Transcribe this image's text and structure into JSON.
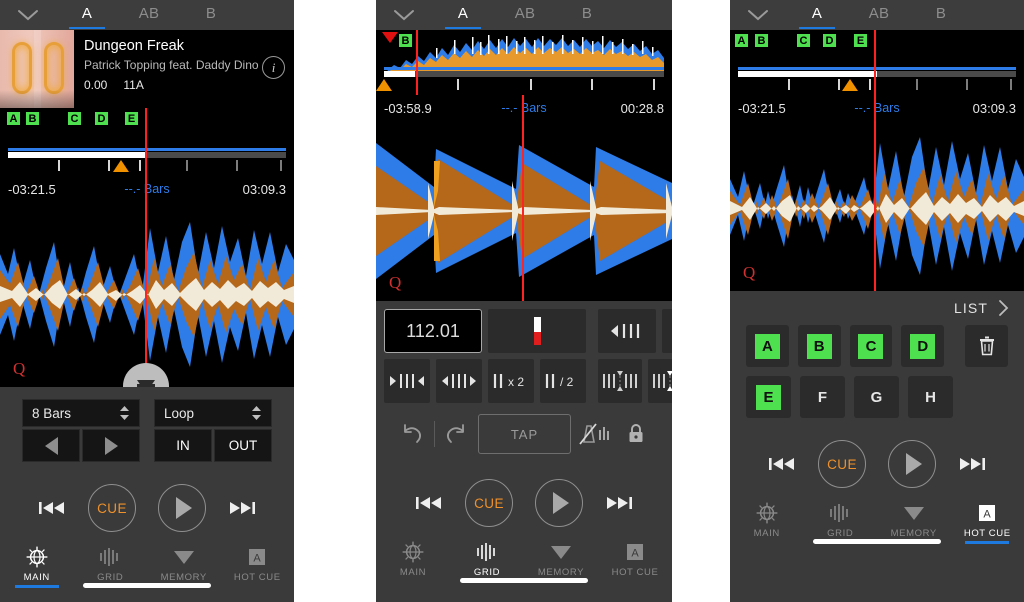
{
  "header": {
    "chevron_icon": "chevron-down-icon",
    "tabs": [
      {
        "label": "A",
        "active": true
      },
      {
        "label": "AB",
        "active": false
      },
      {
        "label": "B",
        "active": false
      }
    ]
  },
  "track": {
    "title": "Dungeon Freak",
    "artist": "Patrick Topping feat. Daddy Dino",
    "gain": "0.00",
    "key": "11A",
    "info_icon": "info-icon"
  },
  "panel1": {
    "overview": {
      "cue_markers": [
        {
          "label": "A",
          "left_pct": 1
        },
        {
          "label": "B",
          "left_pct": 8
        },
        {
          "label": "C",
          "left_pct": 23
        },
        {
          "label": "D",
          "left_pct": 32
        },
        {
          "label": "E",
          "left_pct": 43
        },
        {
          "label": "",
          "left_pct": -99
        }
      ],
      "playhead_pct": 49,
      "position_marker_pct": 42
    },
    "time": {
      "elapsed_remaining": "-03:21.5",
      "bars": "--.- Bars",
      "total": "03:09.3"
    },
    "waveform_cue_label": "Q",
    "beatjump": {
      "value": "8 Bars",
      "prev_icon": "triangle-left-icon",
      "next_icon": "triangle-right-icon"
    },
    "loop": {
      "value": "Loop",
      "in_label": "IN",
      "out_label": "OUT"
    }
  },
  "panel2": {
    "overview": {
      "cue_markers": [
        {
          "label": "B",
          "left_pct": 5
        }
      ],
      "playhead_pct": 11,
      "position_marker_pct": 1
    },
    "time": {
      "elapsed_remaining": "-03:58.9",
      "bars": "--.- Bars",
      "total": "00:28.8"
    },
    "waveform_cue_label": "Q",
    "grid": {
      "bpm": "112.01",
      "tempo_icon": "tempo-slider-icon",
      "nudge_left_icon": "grid-nudge-left-icon",
      "nudge_right_icon": "grid-nudge-right-icon",
      "shrink_icon": "grid-shrink-icon",
      "expand_icon": "grid-expand-icon",
      "x2_label": "x 2",
      "div2_label": "/ 2",
      "slip_left_icon": "grid-slip-left-icon",
      "slip_right_icon": "grid-slip-right-icon",
      "undo_icon": "undo-icon",
      "redo_icon": "redo-icon",
      "tap_label": "TAP",
      "metronome_off_icon": "metronome-mute-icon",
      "lock_icon": "lock-icon"
    }
  },
  "panel3": {
    "overview": {
      "cue_markers": [
        {
          "label": "A",
          "left_pct": 1
        },
        {
          "label": "B",
          "left_pct": 8
        },
        {
          "label": "C",
          "left_pct": 23
        },
        {
          "label": "D",
          "left_pct": 32
        },
        {
          "label": "E",
          "left_pct": 43
        }
      ],
      "playhead_pct": 49,
      "position_marker_pct": 42
    },
    "time": {
      "elapsed_remaining": "-03:21.5",
      "bars": "--.- Bars",
      "total": "03:09.3"
    },
    "waveform_cue_label": "Q",
    "hotcue": {
      "list_label": "LIST",
      "chevron_icon": "chevron-right-icon",
      "delete_icon": "trash-icon",
      "pads": [
        {
          "label": "A",
          "set": true
        },
        {
          "label": "B",
          "set": true
        },
        {
          "label": "C",
          "set": true
        },
        {
          "label": "D",
          "set": true
        },
        {
          "label": "E",
          "set": true
        },
        {
          "label": "F",
          "set": false
        },
        {
          "label": "G",
          "set": false
        },
        {
          "label": "H",
          "set": false
        }
      ]
    }
  },
  "transport": {
    "prev_icon": "skip-back-icon",
    "cue_label": "CUE",
    "play_icon": "play-icon",
    "next_icon": "skip-forward-icon"
  },
  "nav": {
    "items": [
      {
        "label": "MAIN",
        "icon": "globe-icon"
      },
      {
        "label": "GRID",
        "icon": "grid-waveform-icon"
      },
      {
        "label": "MEMORY",
        "icon": "triangle-down-icon"
      },
      {
        "label": "HOT CUE",
        "icon": "hotcue-a-icon"
      }
    ],
    "active": {
      "panel1": "MAIN",
      "panel2": "GRID",
      "panel3": "HOT CUE"
    }
  },
  "colors": {
    "accent_blue": "#1f7ae0",
    "cue_green": "#4ee04e",
    "cue_orange": "#f0912a",
    "playhead_red": "#ff2424",
    "wave_blue": "#2e7ce8",
    "wave_orange": "#b5671a",
    "wave_cream": "#f2ead8"
  }
}
